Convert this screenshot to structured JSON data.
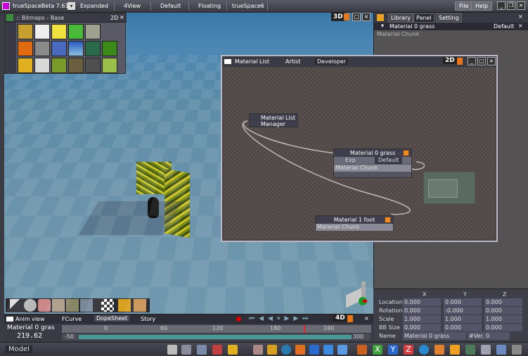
{
  "app": {
    "title": "trueSpaceBeta 7.61"
  },
  "titlebar": {
    "tabs": [
      "Expanded",
      "4View",
      "Default",
      "Floating",
      "trueSpace6"
    ],
    "file_label": "File",
    "help_label": "Help"
  },
  "viewport": {
    "mode_label": "3D"
  },
  "bitmaps": {
    "title": ":: Bitmaps - Base",
    "mode": "2D"
  },
  "right_panel": {
    "tabs": [
      "Library",
      "Panel",
      "Setting"
    ],
    "active_item": "Material 0 grass",
    "default_label": "Default",
    "chunk_label": "Material Chunk"
  },
  "material_window": {
    "title": "Material List",
    "tabs": [
      "Artist",
      "Developer"
    ],
    "mode": "2D",
    "nodes": {
      "manager": {
        "line1": "Material List",
        "line2": "Manager"
      },
      "grass": {
        "title": "Material 0 grass",
        "exp": "Exp",
        "default": "Default",
        "chunk": "Material Chunk"
      },
      "foot": {
        "title": "Material 1 foot",
        "chunk": "Material Chunk"
      }
    }
  },
  "properties": {
    "headers": [
      "X",
      "Y",
      "Z"
    ],
    "rows": [
      {
        "label": "Location",
        "x": "0.000",
        "y": "0.000",
        "z": "0.000"
      },
      {
        "label": "Rotation",
        "x": "0.000",
        "y": "-0.000",
        "z": "0.000"
      },
      {
        "label": "Scale",
        "x": "1.000",
        "y": "1.000",
        "z": "1.000"
      },
      {
        "label": "BB Size",
        "x": "0.000",
        "y": "0.000",
        "z": "0.000"
      }
    ],
    "name_label": "Name",
    "name_value": "Material 0 grass",
    "ver_label": "#Ver. 0"
  },
  "anim": {
    "title": "Anim view",
    "tabs": [
      "FCurve",
      "DopeSheet",
      "Story"
    ],
    "mode": "4D",
    "object": "Material 0 gras",
    "time": "219.62",
    "ticks": [
      "0",
      "60",
      "120",
      "180",
      "240"
    ],
    "range_start": "-50",
    "range_end": "300"
  },
  "bottombar": {
    "mode_label": "Model"
  }
}
